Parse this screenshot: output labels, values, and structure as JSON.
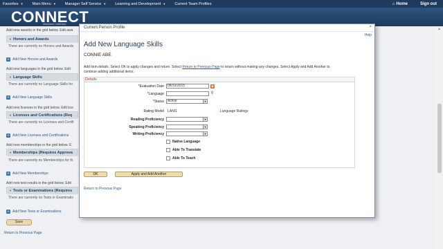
{
  "topbar": {
    "items": [
      "Favorites",
      "Main Menu",
      "Manager Self Service",
      "Learning and Development",
      "Current Team Profiles"
    ],
    "home": "Home",
    "signout": "Sign out"
  },
  "header": {
    "logo": "CONNECT",
    "logo_sub": "Maryland Judiciary"
  },
  "background": {
    "awards_intro": "Add new awards in the grid below. Edit awa",
    "awards_header": "Honors and Awards",
    "awards_empty": "There are currently no Honors and Awards",
    "awards_add": "Add New Honors and Awards",
    "lang_intro": "Add new languages in the grid below. Edit",
    "lang_header": "Language Skills",
    "lang_empty": "There are currently no Language Skills for",
    "lang_add": "Add New Language Skills",
    "lic_intro": "Add new licenses in the grid below. Edit lice",
    "lic_header": "Licenses and Certifications (Req",
    "lic_empty": "There are currently no Licenses and Certifi",
    "lic_add": "Add New Licenses and Certifications",
    "mem_intro": "Add new memberships in the grid below. E",
    "mem_header": "Memberships (Requires Approva",
    "mem_empty": "There are currently no Memberships for th",
    "mem_add": "Add New Memberships",
    "test_intro": "Add new test results in the grid below. Edit",
    "test_header": "Tests or Examinations (Requires",
    "test_empty": "There are currently no Tests or Examinatio",
    "test_add": "Add New Tests or Examinations",
    "save": "Save",
    "return": "Return to Previous Page"
  },
  "modal": {
    "title": "Current Person Profile",
    "close": "×",
    "help": "Help",
    "heading": "Add New Language Skills",
    "person": "CONNIE ABE",
    "instructions_1": "Add item details. Select OK to apply changes and return. Select ",
    "instructions_link": "Return to Previous Page",
    "instructions_2": " to return without making any changes. Select Apply and Add Another to continue adding additional items.",
    "details_header": "Details",
    "fields": {
      "eval_date_label": "*Evaluation Date",
      "eval_date_value": "08/31/2015",
      "language_label": "*Language",
      "language_value": "",
      "status_label": "*Status",
      "status_value": "Active",
      "rating_model_label": "Rating Model",
      "rating_model_value": "LANG",
      "rating_model_desc": "Language Ratings",
      "reading_label": "Reading Proficiency",
      "speaking_label": "Speaking Proficiency",
      "writing_label": "Writing Proficiency",
      "native_label": "Native Language",
      "translate_label": "Able To Translate",
      "teach_label": "Able To Teach"
    },
    "ok": "OK",
    "apply_add": "Apply and Add Another",
    "return": "Return to Previous Page"
  }
}
